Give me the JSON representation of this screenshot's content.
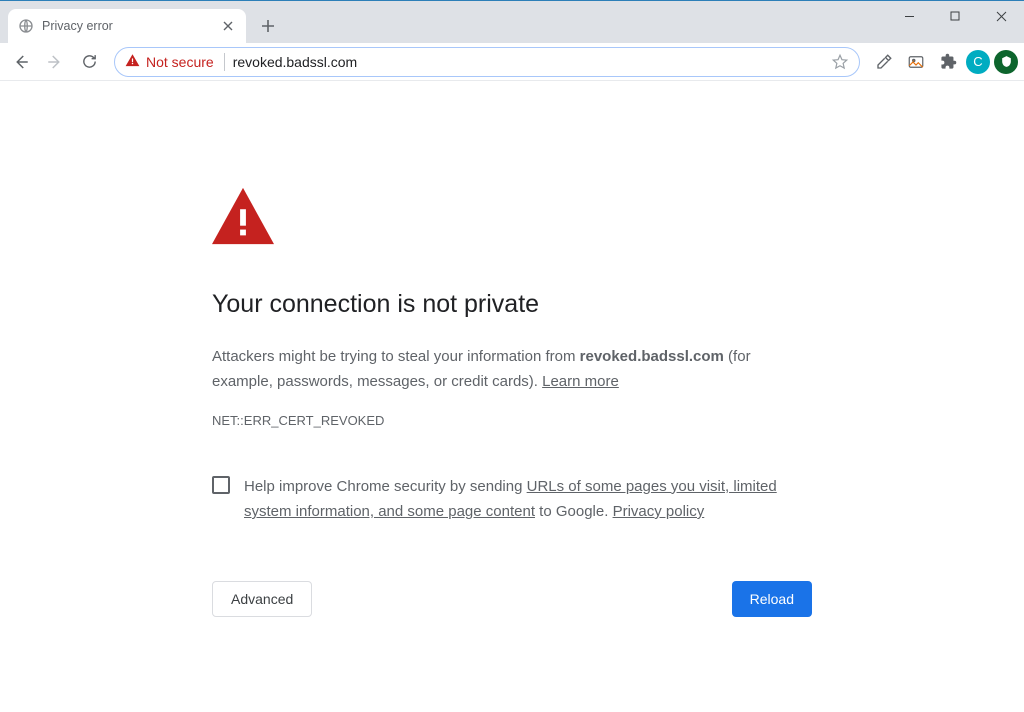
{
  "window": {
    "tab": {
      "title": "Privacy error"
    }
  },
  "toolbar": {
    "security_label": "Not secure",
    "url": "revoked.badssl.com",
    "avatar_initial": "C"
  },
  "page": {
    "heading": "Your connection is not private",
    "desc_before": "Attackers might be trying to steal your information from ",
    "desc_host": "revoked.badssl.com",
    "desc_after": " (for example, passwords, messages, or credit cards). ",
    "learn_more": "Learn more",
    "error_code": "NET::ERR_CERT_REVOKED",
    "opt_in_before": "Help improve Chrome security by sending ",
    "opt_in_link1": "URLs of some pages you visit, limited system information, and some page content",
    "opt_in_mid": " to Google. ",
    "opt_in_link2": "Privacy policy",
    "advanced": "Advanced",
    "reload": "Reload"
  }
}
